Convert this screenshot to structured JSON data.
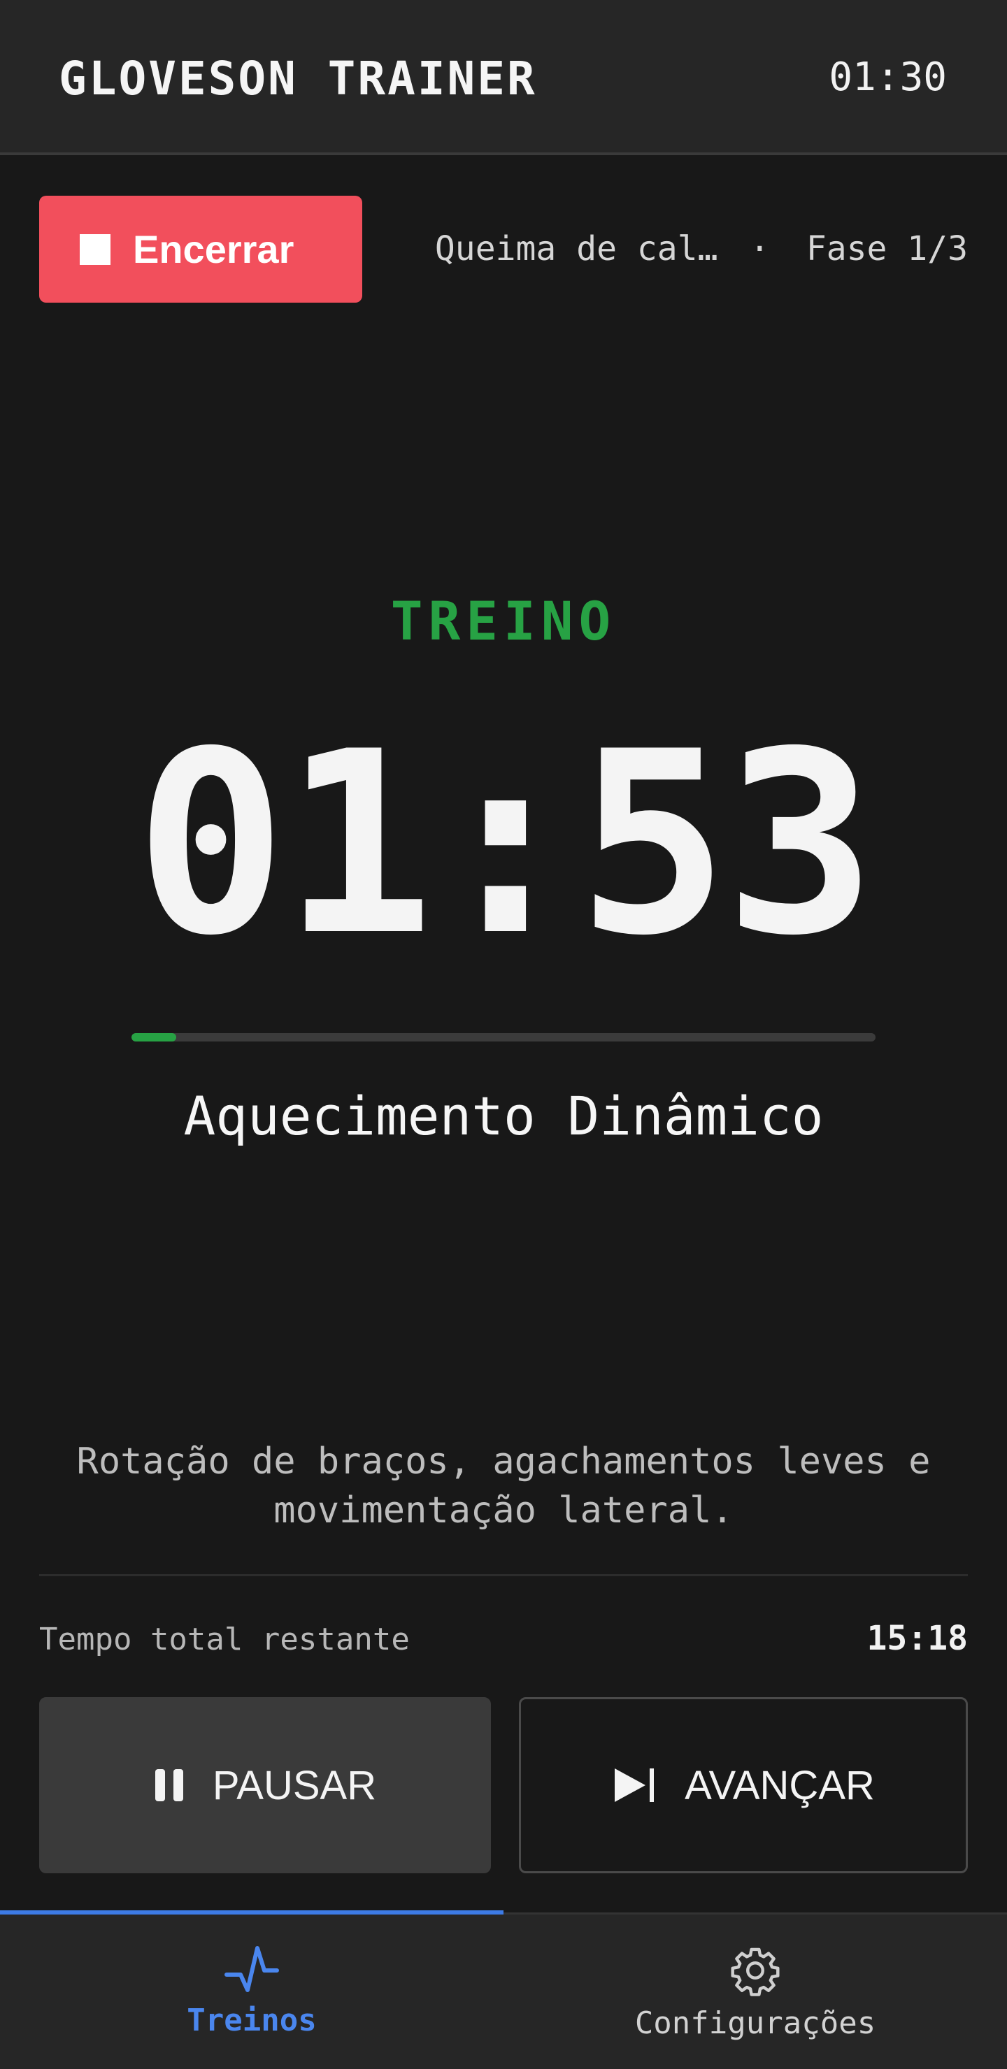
{
  "header": {
    "title": "GLOVESON TRAINER",
    "clock": "01:30"
  },
  "session": {
    "stop_label": "Encerrar",
    "workout_name": "Queima de cal…",
    "separator": "·",
    "phase_progress": "Fase 1/3"
  },
  "phase": {
    "label": "TREINO",
    "timer": "01:53",
    "progress_fraction": 0.06,
    "exercise": "Aquecimento Dinâmico",
    "description": "Rotação de braços, agachamentos leves e movimentação lateral."
  },
  "summary": {
    "remaining_label": "Tempo total restante",
    "remaining_value": "15:18"
  },
  "controls": {
    "pause_label": "PAUSAR",
    "next_label": "AVANÇAR"
  },
  "nav": {
    "items": [
      {
        "label": "Treinos",
        "icon": "activity-icon",
        "active": true
      },
      {
        "label": "Configurações",
        "icon": "gear-icon",
        "active": false
      }
    ]
  },
  "colors": {
    "background": "#181818",
    "bar": "#262626",
    "danger": "#f24f5c",
    "phase_green": "#27a244",
    "accent_blue": "#4a86ee"
  }
}
